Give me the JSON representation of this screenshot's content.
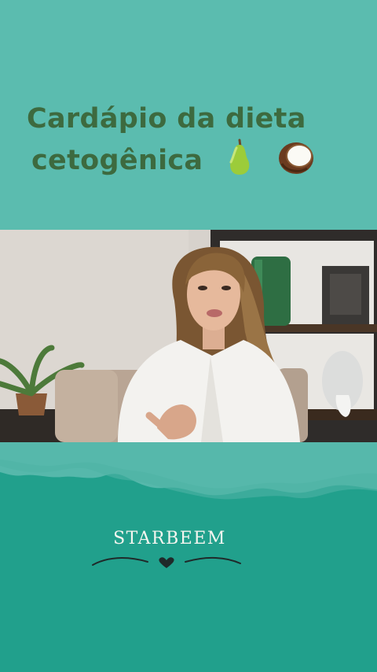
{
  "header": {
    "title_line1": "Cardápio da dieta",
    "title_line2": "cetogênica",
    "emojis": [
      "pear-emoji",
      "coconut-emoji"
    ]
  },
  "video": {
    "content": "woman-speaking-video-frame"
  },
  "footer": {
    "brand": "STARBEEM"
  },
  "colors": {
    "background": "#5bbcaf",
    "title": "#3d6a3f",
    "footer": "#21a08c",
    "brand_text": "#f5f5ef"
  }
}
